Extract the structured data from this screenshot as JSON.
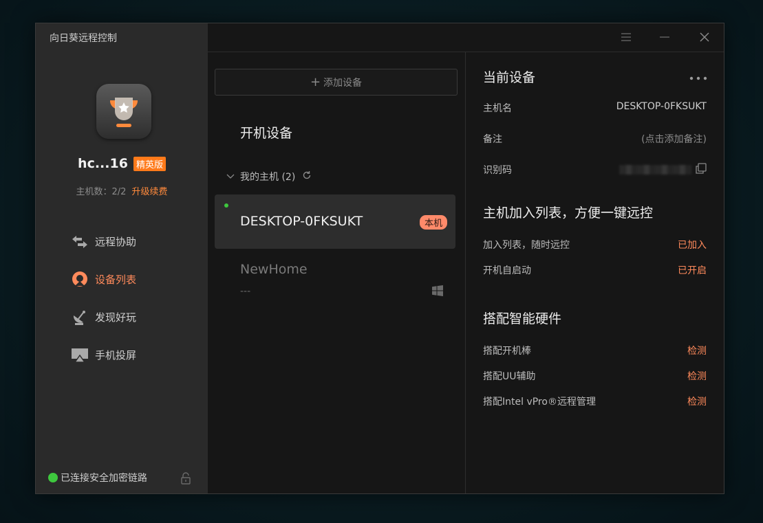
{
  "app": {
    "title": "向日葵远程控制"
  },
  "account": {
    "username": "hc...16",
    "tier": "精英版",
    "host_count": "主机数：2/2",
    "upgrade": "升级续费"
  },
  "nav": {
    "items": [
      {
        "label": "远程协助",
        "icon": "remote-assist-icon"
      },
      {
        "label": "设备列表",
        "icon": "device-list-icon"
      },
      {
        "label": "发现好玩",
        "icon": "discover-icon"
      },
      {
        "label": "手机投屏",
        "icon": "screen-cast-icon"
      }
    ],
    "active_index": 1
  },
  "status": {
    "text": "已连接安全加密链路"
  },
  "device_panel": {
    "add_label": "添加设备",
    "section_title": "开机设备",
    "group_label": "我的主机 (2)",
    "devices": [
      {
        "name": "DESKTOP-0FKSUKT",
        "badge": "本机",
        "online": true
      },
      {
        "name": "NewHome",
        "sub": "---",
        "os": "windows-icon"
      }
    ]
  },
  "details": {
    "title": "当前设备",
    "hostname_label": "主机名",
    "hostname_value": "DESKTOP-0FKSUKT",
    "note_label": "备注",
    "note_value": "(点击添加备注)",
    "idcode_label": "识别码",
    "list_heading": "主机加入列表，方便一键远控",
    "join_label": "加入列表，随时远控",
    "join_value": "已加入",
    "autostart_label": "开机自启动",
    "autostart_value": "已开启",
    "hw_heading": "搭配智能硬件",
    "hw_items": [
      {
        "label": "搭配开机棒",
        "action": "检测"
      },
      {
        "label": "搭配UU辅助",
        "action": "检测"
      },
      {
        "label": "搭配Intel vPro®远程管理",
        "action": "检测"
      }
    ]
  },
  "colors": {
    "accent": "#ff8a5b",
    "badge_orange": "#ff7a1a",
    "online_green": "#3ec73e"
  }
}
